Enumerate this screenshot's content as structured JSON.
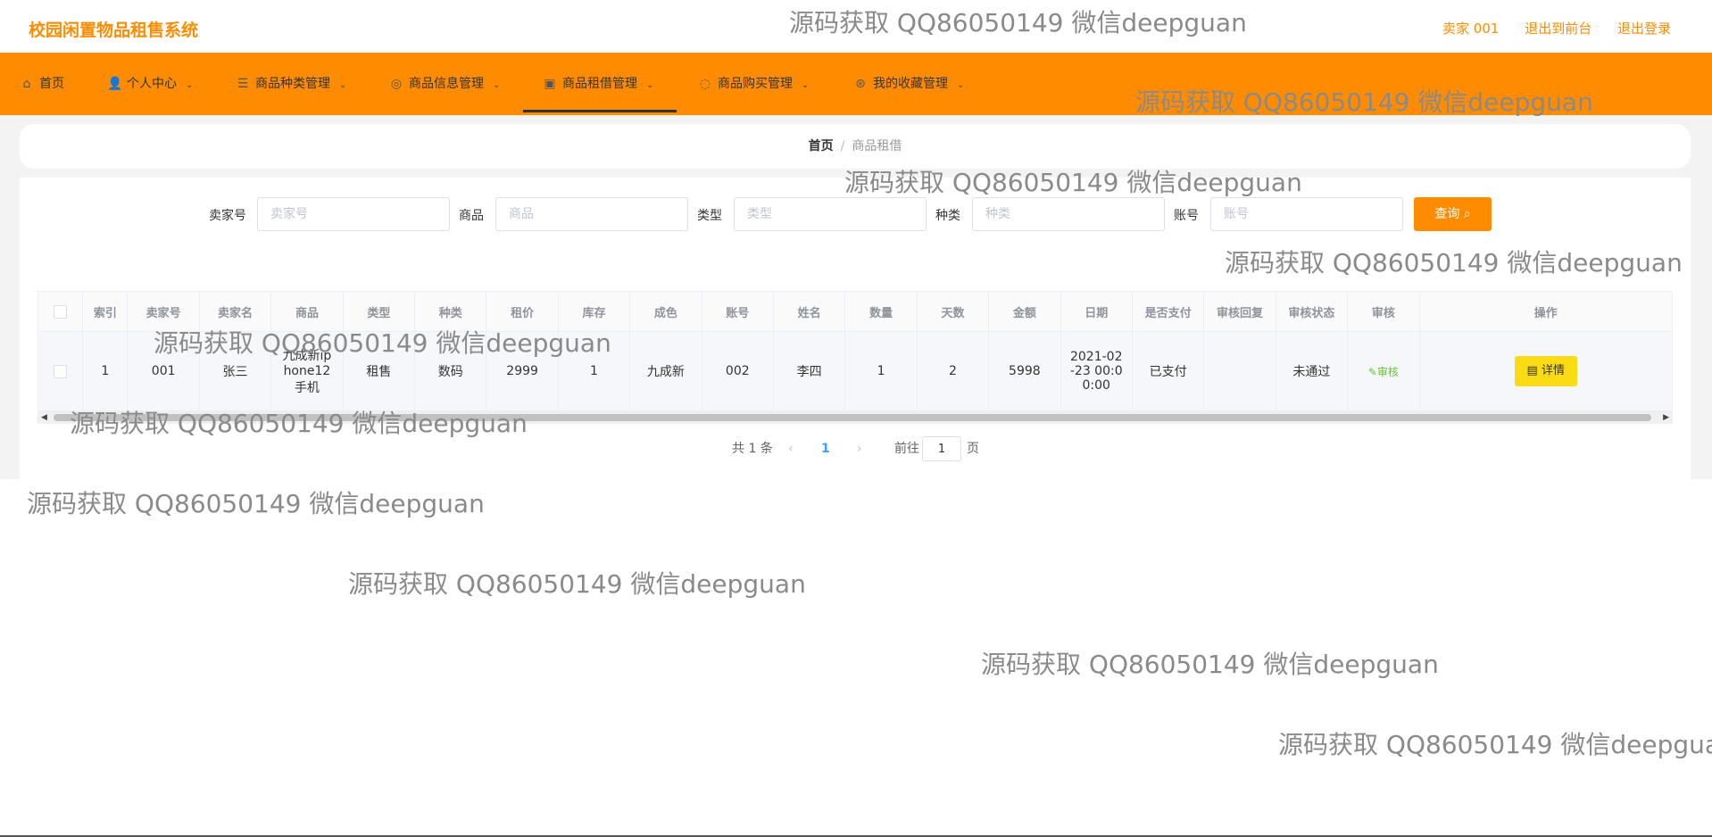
{
  "app": {
    "title": "校园闲置物品租售系统"
  },
  "header": {
    "user_label": "卖家 001",
    "front_link": "退出到前台",
    "logout_link": "退出登录"
  },
  "nav": {
    "items": [
      {
        "label": "首页",
        "icon": "home-icon",
        "glyph": "⌂",
        "has_dropdown": false
      },
      {
        "label": "个人中心",
        "icon": "user-icon",
        "glyph": "👤",
        "has_dropdown": true
      },
      {
        "label": "商品种类管理",
        "icon": "list-icon",
        "glyph": "☰",
        "has_dropdown": true
      },
      {
        "label": "商品信息管理",
        "icon": "info-icon",
        "glyph": "◎",
        "has_dropdown": true
      },
      {
        "label": "商品租借管理",
        "icon": "rent-icon",
        "glyph": "▣",
        "has_dropdown": true,
        "active": true
      },
      {
        "label": "商品购买管理",
        "icon": "buy-icon",
        "glyph": "◌",
        "has_dropdown": true
      },
      {
        "label": "我的收藏管理",
        "icon": "favorite-icon",
        "glyph": "⊛",
        "has_dropdown": true
      }
    ]
  },
  "breadcrumb": {
    "home": "首页",
    "separator": "/",
    "current": "商品租借"
  },
  "search": {
    "seller_label": "卖家号",
    "seller_placeholder": "卖家号",
    "product_label": "商品",
    "product_placeholder": "商品",
    "type_label": "类型",
    "type_placeholder": "类型",
    "category_label": "种类",
    "category_placeholder": "种类",
    "account_label": "账号",
    "account_placeholder": "账号",
    "query_button": "查询",
    "query_icon": "search-icon"
  },
  "table": {
    "columns": [
      "索引",
      "卖家号",
      "卖家名",
      "商品",
      "类型",
      "种类",
      "租价",
      "库存",
      "成色",
      "账号",
      "姓名",
      "数量",
      "天数",
      "金额",
      "日期",
      "是否支付",
      "审核回复",
      "审核状态",
      "审核",
      "操作"
    ],
    "rows": [
      {
        "index": "1",
        "seller_no": "001",
        "seller_name": "张三",
        "product": "九成新iphone12手机",
        "type": "租售",
        "category": "数码",
        "rent_price": "2999",
        "stock": "1",
        "condition": "九成新",
        "account": "002",
        "name": "李四",
        "quantity": "1",
        "days": "2",
        "amount": "5998",
        "date": "2021-02-23 00:00:00",
        "paid": "已支付",
        "reply": "",
        "status": "未通过",
        "audit_link": "审核",
        "detail_button": "详情"
      }
    ]
  },
  "pagination": {
    "total": "共 1 条",
    "prev": "‹",
    "current": "1",
    "next": "›",
    "goto_label": "前往",
    "goto_value": "1",
    "page_suffix": "页"
  },
  "watermark": "源码获取 QQ86050149 微信deepguan",
  "colors": {
    "accent": "#ff8c00",
    "detail_button": "#fadb14",
    "audit_link": "#67c23a"
  }
}
